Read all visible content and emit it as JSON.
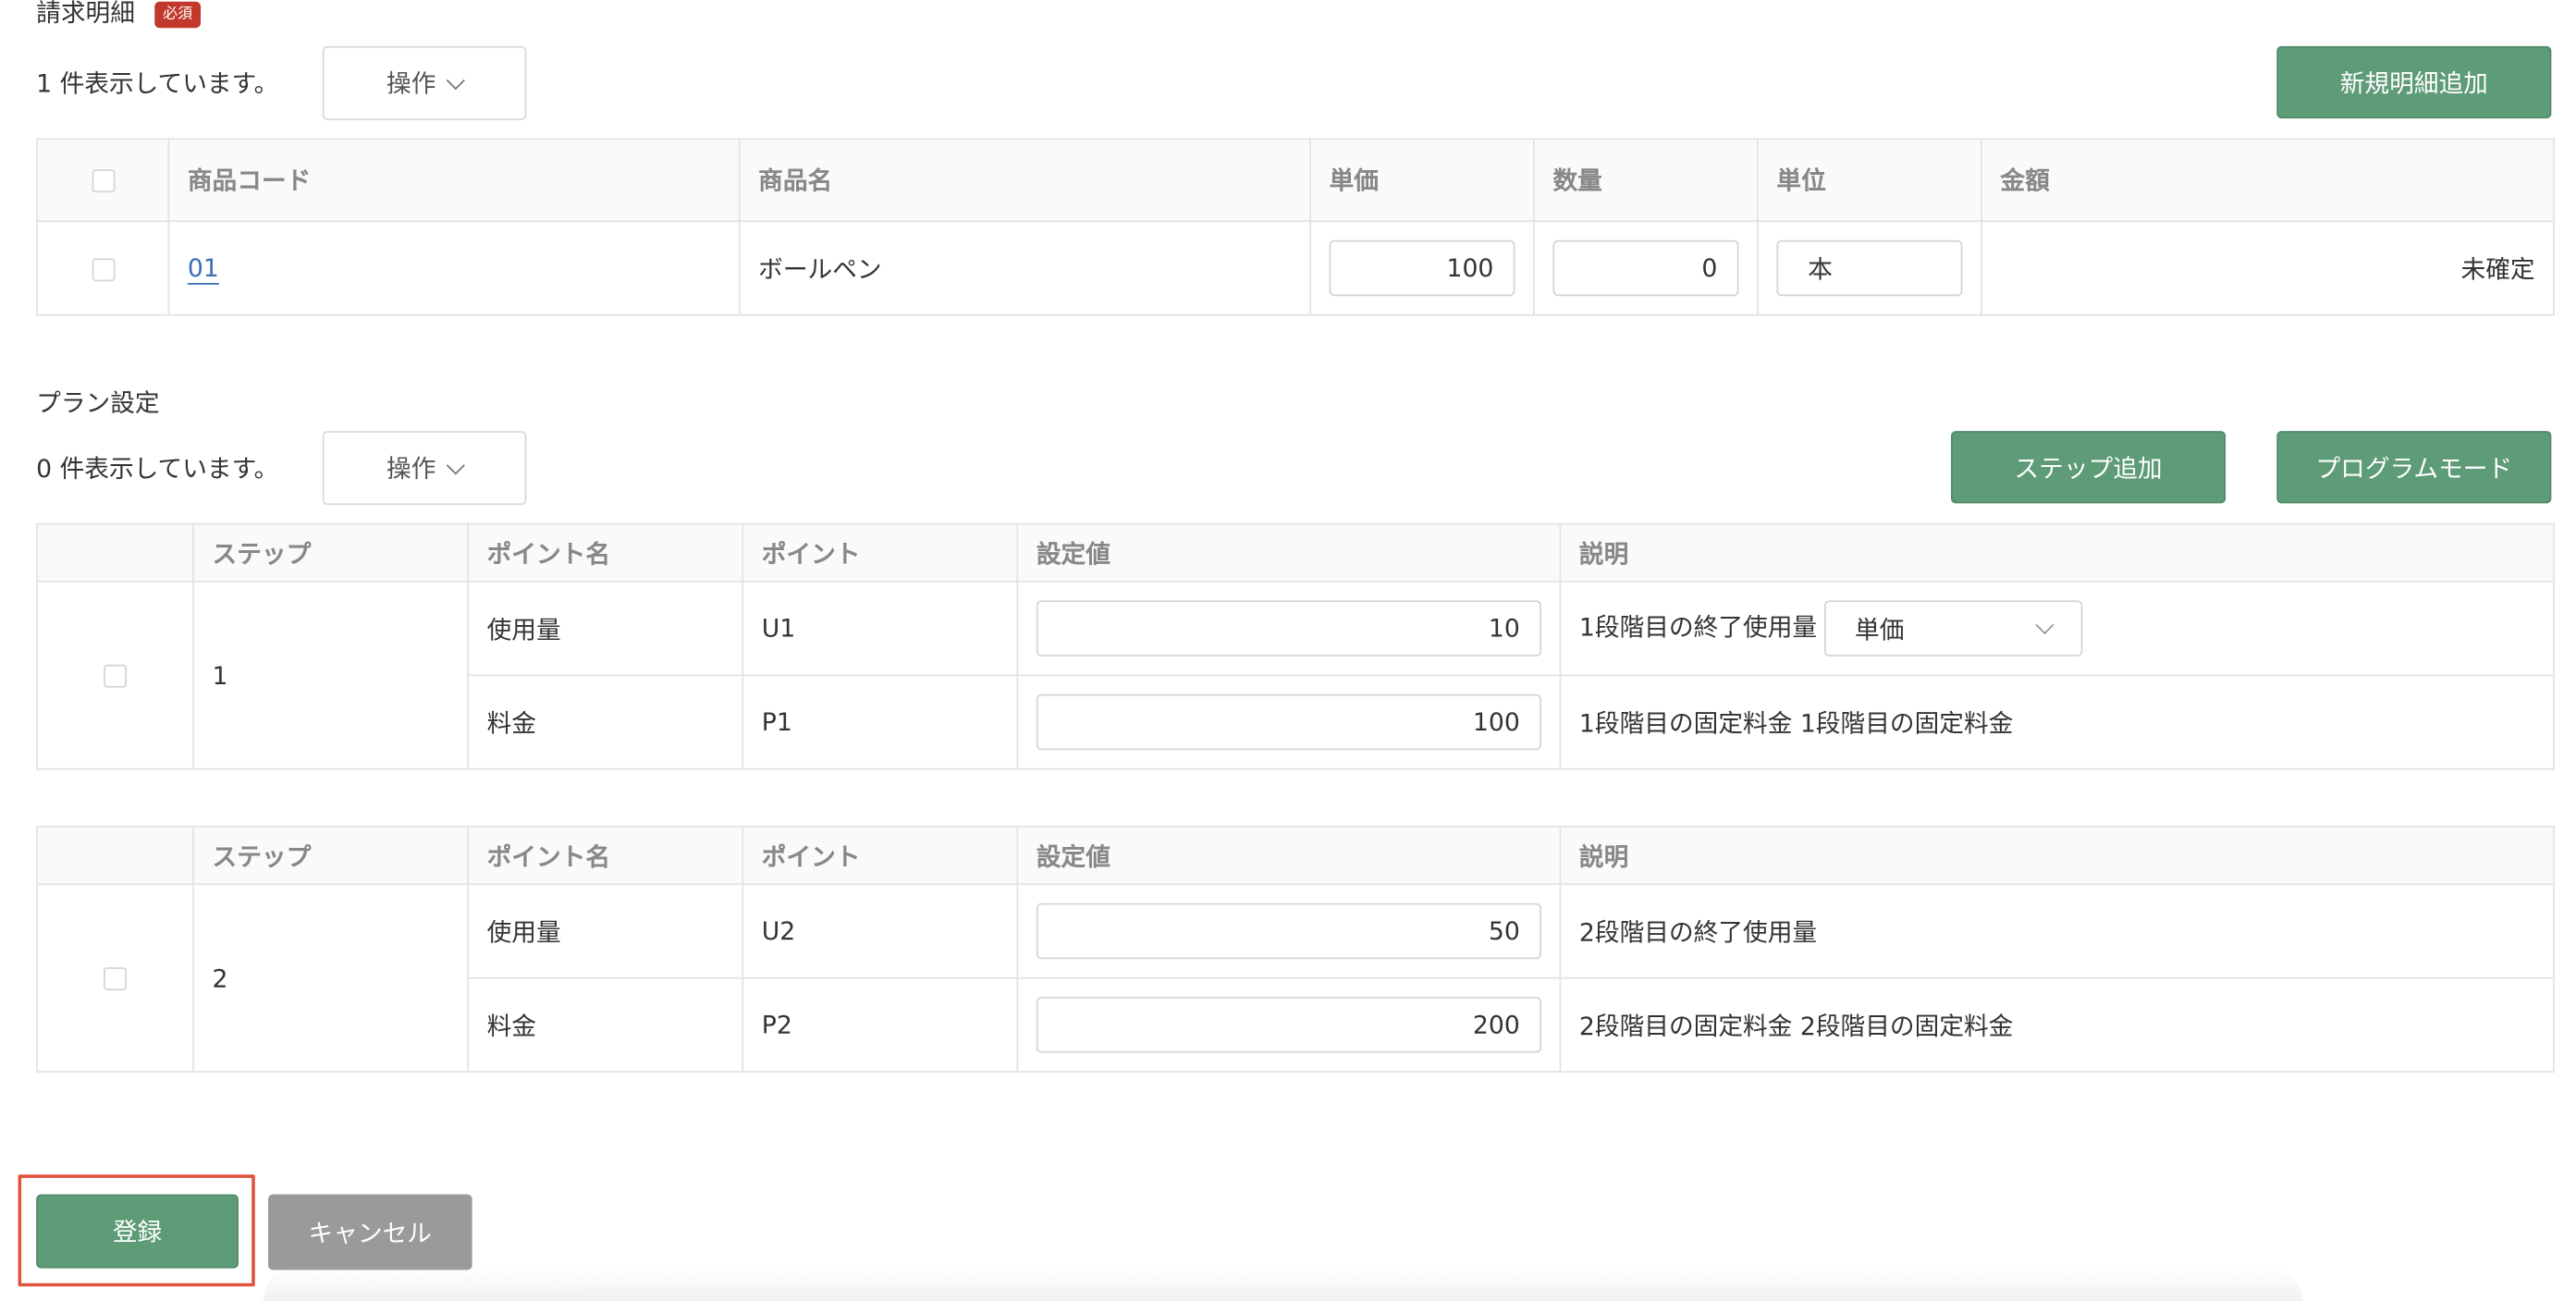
{
  "billing": {
    "title": "請求明細",
    "required_badge": "必須",
    "count_text": "1 件表示しています。",
    "ops_label": "操作",
    "add_button": "新規明細追加",
    "headers": [
      "商品コード",
      "商品名",
      "単価",
      "数量",
      "単位",
      "金額"
    ],
    "row": {
      "code": "01",
      "name": "ボールペン",
      "unit_price": "100",
      "quantity": "0",
      "unit": "本",
      "amount": "未確定"
    }
  },
  "plan": {
    "title": "プラン設定",
    "count_text": "0 件表示しています。",
    "ops_label": "操作",
    "step_add_button": "ステップ追加",
    "program_mode_button": "プログラムモード",
    "headers": [
      "ステップ",
      "ポイント名",
      "ポイント",
      "設定値",
      "説明"
    ],
    "steps": [
      {
        "step": "1",
        "rows": [
          {
            "point_name": "使用量",
            "point": "U1",
            "value": "10",
            "desc": "1段階目の終了使用量",
            "select": "単価"
          },
          {
            "point_name": "料金",
            "point": "P1",
            "value": "100",
            "desc": "1段階目の固定料金 1段階目の固定料金"
          }
        ]
      },
      {
        "step": "2",
        "rows": [
          {
            "point_name": "使用量",
            "point": "U2",
            "value": "50",
            "desc": "2段階目の終了使用量"
          },
          {
            "point_name": "料金",
            "point": "P2",
            "value": "200",
            "desc": "2段階目の固定料金 2段階目の固定料金"
          }
        ]
      }
    ]
  },
  "footer": {
    "submit": "登録",
    "cancel": "キャンセル"
  }
}
